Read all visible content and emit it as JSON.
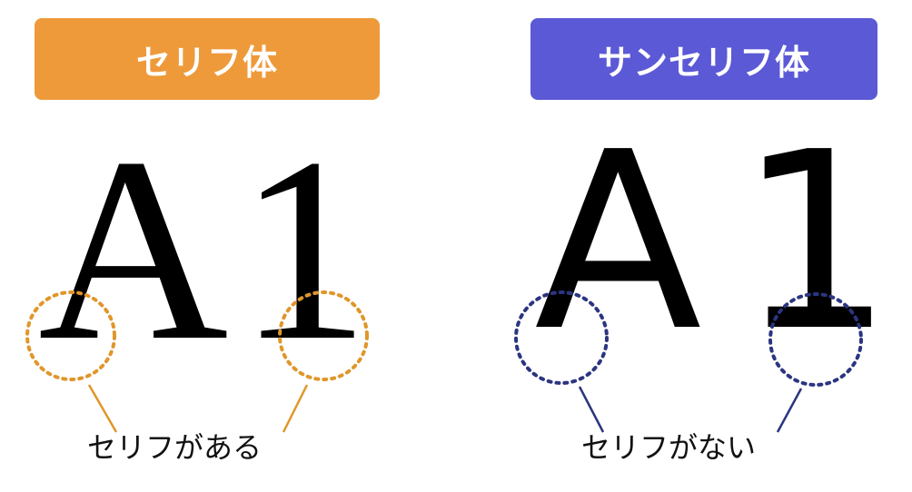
{
  "serif": {
    "header_label": "セリフ体",
    "header_color": "#EE9A3A",
    "glyph_a": "A",
    "glyph_1": "1",
    "caption": "セリフがある",
    "marker_color": "#E0962A"
  },
  "sans_serif": {
    "header_label": "サンセリフ体",
    "header_color": "#5B59D6",
    "glyph_a": "A",
    "glyph_1": "1",
    "caption": "セリフがない",
    "marker_color": "#2B3580"
  }
}
